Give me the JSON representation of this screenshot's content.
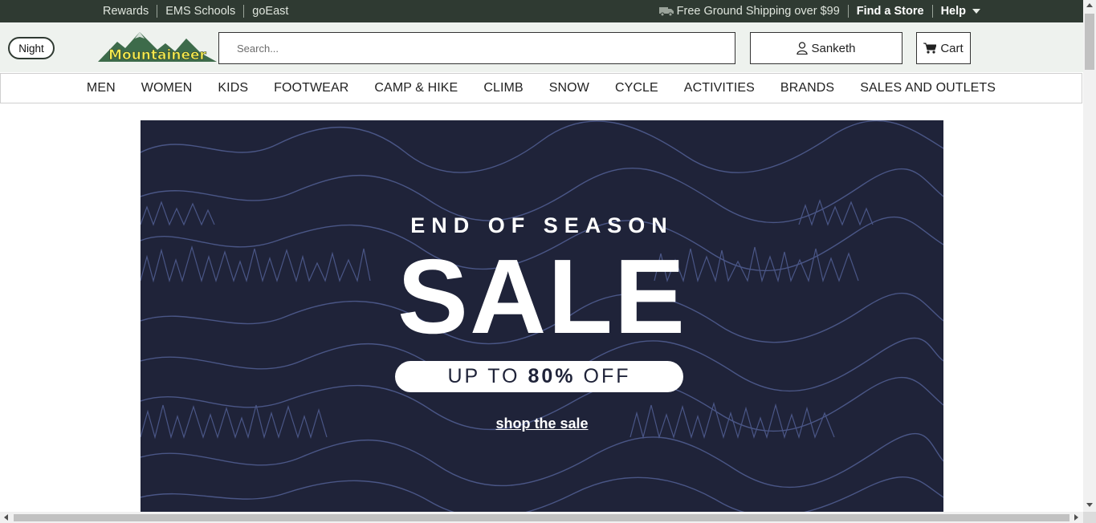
{
  "topbar": {
    "links": [
      "Rewards",
      "EMS Schools",
      "goEast"
    ],
    "shipping_text": "Free Ground Shipping over $99",
    "find_store": "Find a Store",
    "help": "Help"
  },
  "header": {
    "night_toggle": "Night",
    "logo_text": "Mountaineer",
    "search_placeholder": "Search...",
    "account_name": "Sanketh",
    "cart_label": "Cart"
  },
  "nav": {
    "items": [
      "MEN",
      "WOMEN",
      "KIDS",
      "FOOTWEAR",
      "CAMP & HIKE",
      "CLIMB",
      "SNOW",
      "CYCLE",
      "ACTIVITIES",
      "BRANDS",
      "SALES AND OUTLETS"
    ]
  },
  "hero": {
    "eyebrow": "END OF SEASON",
    "headline": "SALE",
    "pill_prefix": "UP TO",
    "pill_bold": "80%",
    "pill_suffix": "OFF",
    "cta": "shop the sale"
  },
  "colors": {
    "topbar_bg": "#2f3a32",
    "header_bg": "#eef2ee",
    "hero_bg": "#1f2339",
    "hero_pattern": "#4a5686",
    "logo_green": "#3d6b4a",
    "logo_text": "#f2e94e"
  },
  "icons": {
    "truck": "truck-icon",
    "user": "user-icon",
    "cart": "cart-icon",
    "caret": "caret-down-icon"
  }
}
